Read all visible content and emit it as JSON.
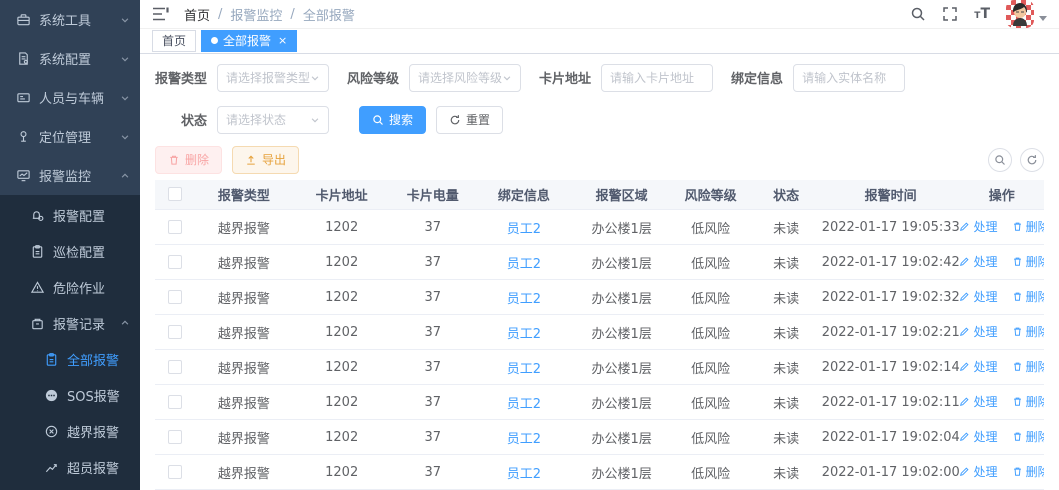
{
  "colors": {
    "accent": "#409eff",
    "sidebar_bg": "#304156",
    "submenu_bg": "#1f2d3d",
    "danger": "#f56c6c",
    "warning": "#e6a23c"
  },
  "sidebar": {
    "items": [
      {
        "label": "系统工具",
        "icon": "toolbox-icon"
      },
      {
        "label": "系统配置",
        "icon": "system-config-icon"
      },
      {
        "label": "人员与车辆",
        "icon": "id-card-icon"
      },
      {
        "label": "定位管理",
        "icon": "location-pin-icon"
      },
      {
        "label": "报警监控",
        "icon": "monitor-icon"
      }
    ],
    "alarm_monitor_children": [
      {
        "label": "报警配置",
        "icon": "alarm-config-icon"
      },
      {
        "label": "巡检配置",
        "icon": "patrol-config-icon"
      },
      {
        "label": "危险作业",
        "icon": "warning-triangle-icon"
      },
      {
        "label": "报警记录",
        "icon": "alarm-record-icon"
      }
    ],
    "alarm_record_children": [
      {
        "label": "全部报警",
        "icon": "clipboard-icon",
        "active": true
      },
      {
        "label": "SOS报警",
        "icon": "sos-icon"
      },
      {
        "label": "越界报警",
        "icon": "circle-x-icon"
      },
      {
        "label": "超员报警",
        "icon": "trend-icon"
      }
    ]
  },
  "topbar": {
    "breadcrumb": {
      "items": [
        "首页",
        "报警监控",
        "全部报警"
      ],
      "separator": "/"
    }
  },
  "tabs": {
    "home": "首页",
    "active_tab": "全部报警",
    "close_glyph": "×"
  },
  "filters": {
    "alarm_type": {
      "label": "报警类型",
      "placeholder": "请选择报警类型"
    },
    "risk_level": {
      "label": "风险等级",
      "placeholder": "请选择风险等级"
    },
    "card_address": {
      "label": "卡片地址",
      "placeholder": "请输入卡片地址",
      "value": ""
    },
    "bind_info": {
      "label": "绑定信息",
      "placeholder": "请输入实体名称",
      "value": ""
    },
    "status": {
      "label": "状态",
      "placeholder": "请选择状态"
    },
    "search_label": "搜索",
    "reset_label": "重置"
  },
  "toolbar": {
    "delete_label": "删除",
    "export_label": "导出"
  },
  "table": {
    "headers": [
      "报警类型",
      "卡片地址",
      "卡片电量",
      "绑定信息",
      "报警区域",
      "风险等级",
      "状态",
      "报警时间",
      "操作"
    ],
    "action_handle": "处理",
    "action_delete": "删除",
    "rows": [
      {
        "type": "越界报警",
        "card": "1202",
        "battery": "37",
        "bind": "员工2",
        "area": "办公楼1层",
        "risk": "低风险",
        "status": "未读",
        "time": "2022-01-17 19:05:33"
      },
      {
        "type": "越界报警",
        "card": "1202",
        "battery": "37",
        "bind": "员工2",
        "area": "办公楼1层",
        "risk": "低风险",
        "status": "未读",
        "time": "2022-01-17 19:02:42"
      },
      {
        "type": "越界报警",
        "card": "1202",
        "battery": "37",
        "bind": "员工2",
        "area": "办公楼1层",
        "risk": "低风险",
        "status": "未读",
        "time": "2022-01-17 19:02:32"
      },
      {
        "type": "越界报警",
        "card": "1202",
        "battery": "37",
        "bind": "员工2",
        "area": "办公楼1层",
        "risk": "低风险",
        "status": "未读",
        "time": "2022-01-17 19:02:21"
      },
      {
        "type": "越界报警",
        "card": "1202",
        "battery": "37",
        "bind": "员工2",
        "area": "办公楼1层",
        "risk": "低风险",
        "status": "未读",
        "time": "2022-01-17 19:02:14"
      },
      {
        "type": "越界报警",
        "card": "1202",
        "battery": "37",
        "bind": "员工2",
        "area": "办公楼1层",
        "risk": "低风险",
        "status": "未读",
        "time": "2022-01-17 19:02:11"
      },
      {
        "type": "越界报警",
        "card": "1202",
        "battery": "37",
        "bind": "员工2",
        "area": "办公楼1层",
        "risk": "低风险",
        "status": "未读",
        "time": "2022-01-17 19:02:04"
      },
      {
        "type": "越界报警",
        "card": "1202",
        "battery": "37",
        "bind": "员工2",
        "area": "办公楼1层",
        "risk": "低风险",
        "status": "未读",
        "time": "2022-01-17 19:02:00"
      }
    ]
  }
}
